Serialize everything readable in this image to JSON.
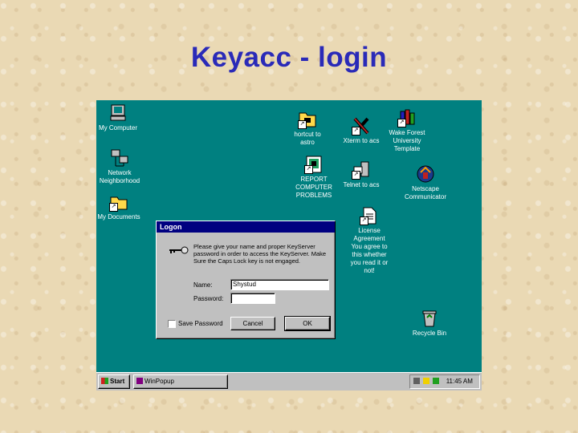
{
  "slide": {
    "title": "Keyacc - login"
  },
  "desktop": {
    "icons": [
      {
        "label": "My Computer"
      },
      {
        "label": "Network\nNeighborhood"
      },
      {
        "label": "My Documents"
      },
      {
        "label": "hortcut to\nastro"
      },
      {
        "label": "Xterm to acs"
      },
      {
        "label": "Wake Forest\nUniversity\nTemplate"
      },
      {
        "label": "REPORT\nCOMPUTER\nPROBLEMS"
      },
      {
        "label": "Telnet to acs"
      },
      {
        "label": "Netscape\nCommunicator"
      },
      {
        "label": "License\nAgreement\nYou agree to\nthis whether\nyou read it or\nnot!"
      },
      {
        "label": "Recycle Bin"
      }
    ]
  },
  "dialog": {
    "title": "Logon",
    "message": "Please give your name and proper KeyServer password in order to access the KeyServer. Make Sure the Caps Lock key is not engaged.",
    "name_label": "Name:",
    "name_value": "Shystud",
    "password_label": "Password:",
    "password_value": "",
    "save_password_label": "Save Password",
    "cancel_label": "Cancel",
    "ok_label": "OK"
  },
  "taskbar": {
    "start_label": "Start",
    "task_label": "WinPopup",
    "clock": "11:45 AM"
  }
}
